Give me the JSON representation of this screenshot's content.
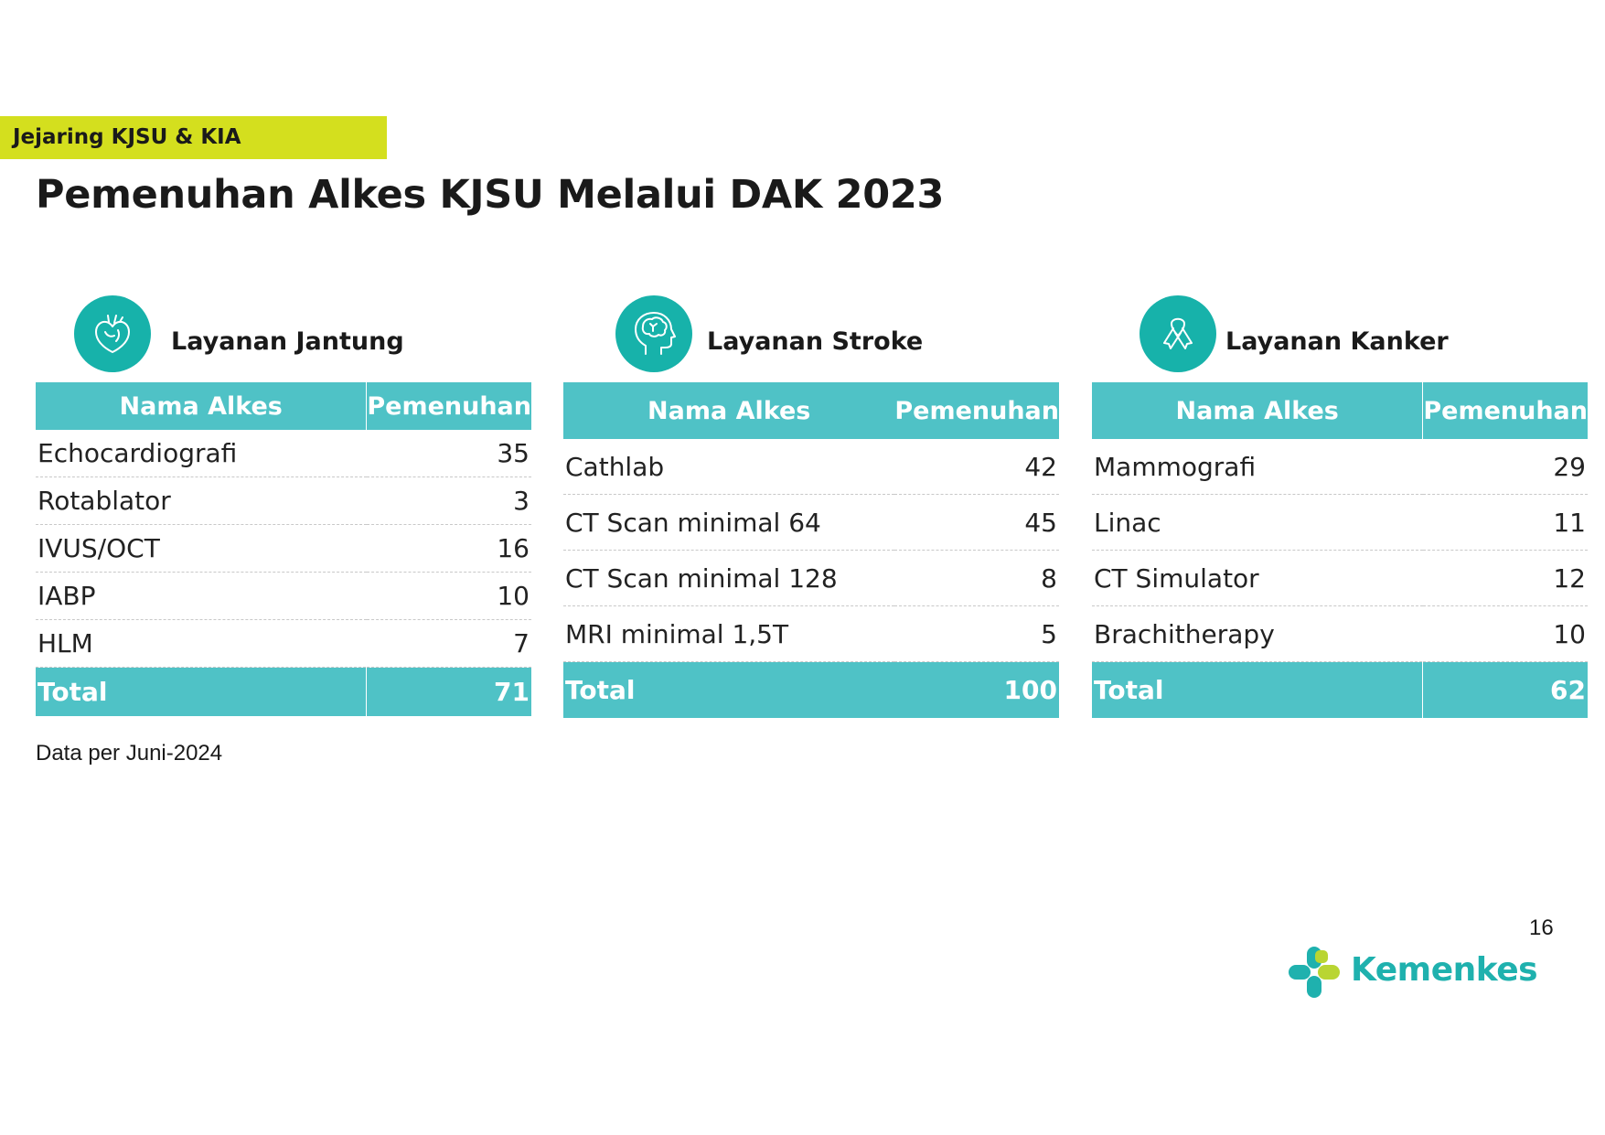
{
  "header": {
    "tag": "Jejaring KJSU & KIA",
    "title": "Pemenuhan Alkes KJSU Melalui DAK 2023"
  },
  "colors": {
    "teal": "#4fc2c6",
    "icon_teal": "#17b2aa",
    "tag_lime": "#d4df1e",
    "logo_teal": "#1fb1ae",
    "logo_lime": "#b9d532"
  },
  "sections": [
    {
      "icon": "heart-icon",
      "title": "Layanan Jantung",
      "header_name": "Nama Alkes",
      "header_value": "Pemenuhan",
      "rows": [
        {
          "name": "Echocardiografi",
          "value": "35"
        },
        {
          "name": "Rotablator",
          "value": "3"
        },
        {
          "name": "IVUS/OCT",
          "value": "16"
        },
        {
          "name": "IABP",
          "value": "10"
        },
        {
          "name": "HLM",
          "value": "7"
        }
      ],
      "total_label": "Total",
      "total_value": "71"
    },
    {
      "icon": "brain-head-icon",
      "title": "Layanan Stroke",
      "header_name": "Nama Alkes",
      "header_value": "Pemenuhan",
      "rows": [
        {
          "name": "Cathlab",
          "value": "42"
        },
        {
          "name": "CT Scan minimal 64",
          "value": "45"
        },
        {
          "name": "CT Scan minimal 128",
          "value": "8"
        },
        {
          "name": "MRI minimal 1,5T",
          "value": "5"
        }
      ],
      "total_label": "Total",
      "total_value": "100"
    },
    {
      "icon": "ribbon-icon",
      "title": "Layanan Kanker",
      "header_name": "Nama Alkes",
      "header_value": "Pemenuhan",
      "rows": [
        {
          "name": "Mammografi",
          "value": "29"
        },
        {
          "name": "Linac",
          "value": "11"
        },
        {
          "name": "CT Simulator",
          "value": "12"
        },
        {
          "name": "Brachitherapy",
          "value": "10"
        }
      ],
      "total_label": "Total",
      "total_value": "62"
    }
  ],
  "footer": {
    "note": "Data per Juni-2024",
    "page_number": "16",
    "logo_text": "Kemenkes"
  }
}
